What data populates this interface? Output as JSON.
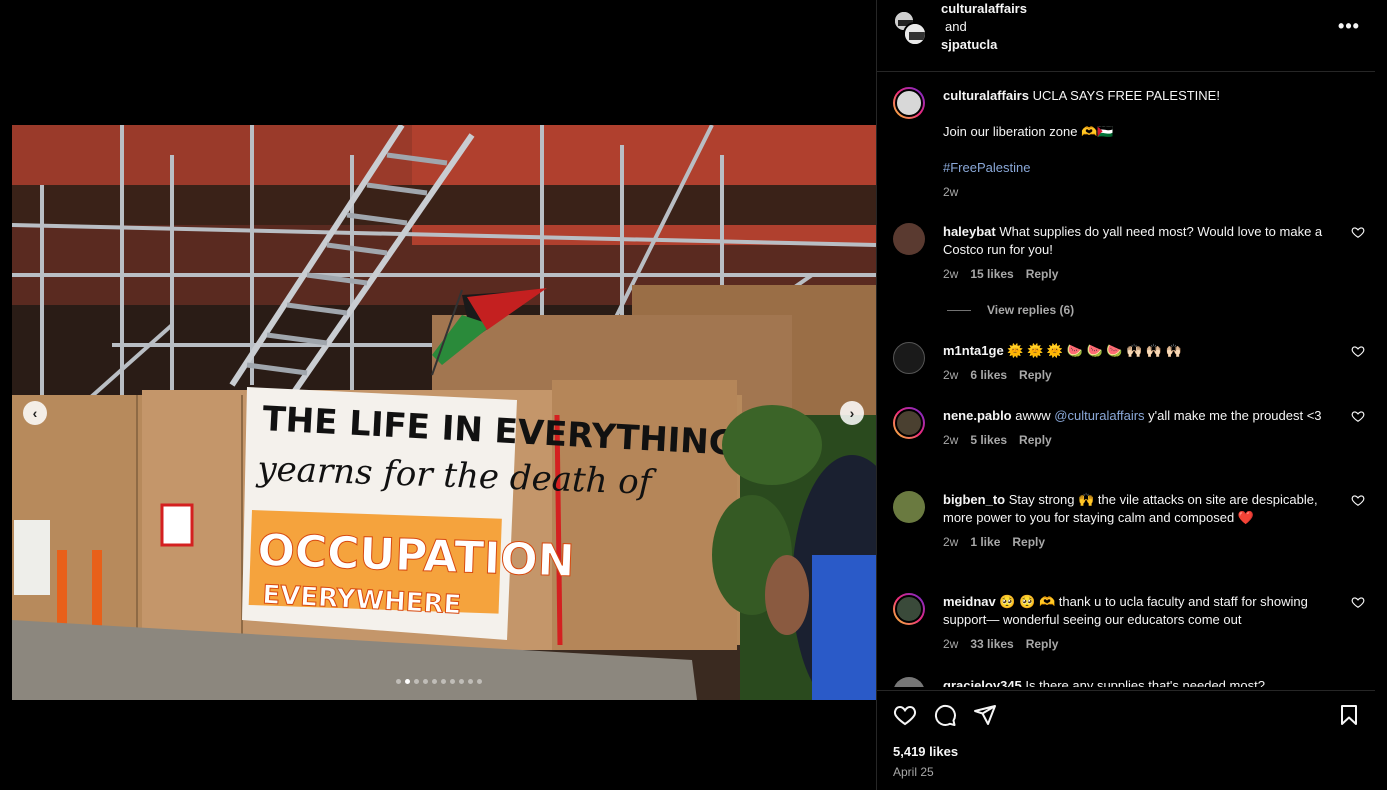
{
  "header": {
    "user1": "culturalaffairs",
    "and_text": "and",
    "user2": "sjpatucla",
    "more_label": "•••"
  },
  "carousel": {
    "total_slides": 10,
    "active_slide": 2,
    "prev_label": "‹",
    "next_label": "›",
    "banner_lines": [
      "THE LIFE IN EVERYTHING",
      "yearns for the death of",
      "OCCUPATION",
      "EVERYWHERE"
    ]
  },
  "caption": {
    "user": "culturalaffairs",
    "text": "UCLA SAYS FREE PALESTINE!",
    "line2": "Join our liberation zone 🫶🇵🇸",
    "hashtag": "#FreePalestine",
    "time": "2w"
  },
  "comments": [
    {
      "user": "haleybat",
      "text": "What supplies do yall need most? Would love to make a Costco run for you!",
      "time": "2w",
      "likes": "15 likes",
      "reply": "Reply"
    },
    {
      "user": "m1nta1ge",
      "text": "🌞 🌞 🌞 🍉 🍉 🍉 🙌🏻 🙌🏻 🙌🏻",
      "time": "2w",
      "likes": "6 likes",
      "reply": "Reply"
    },
    {
      "user": "nene.pablo",
      "text_pre": "awww ",
      "mention": "@culturalaffairs",
      "text_post": " y'all make me the proudest <3",
      "time": "2w",
      "likes": "5 likes",
      "reply": "Reply"
    },
    {
      "user": "bigben_to",
      "text": "Stay strong 🙌 the vile attacks on site are despicable, more power to you for staying calm and composed ❤️",
      "time": "2w",
      "likes": "1 like",
      "reply": "Reply"
    },
    {
      "user": "meidnav",
      "text": "🥺 🥺 🫶 thank u to ucla faculty and staff for showing support— wonderful seeing our educators come out",
      "time": "2w",
      "likes": "33 likes",
      "reply": "Reply"
    },
    {
      "user": "gracieloy345",
      "text": "Is there any supplies that's needed most?"
    }
  ],
  "view_replies": "View replies (6)",
  "footer": {
    "likes": "5,419 likes",
    "date": "April 25"
  },
  "colors": {
    "background": "#000000",
    "text": "#f5f5f5",
    "secondary": "#a8a8a8",
    "link": "#8aa8d8",
    "divider": "#262626"
  }
}
